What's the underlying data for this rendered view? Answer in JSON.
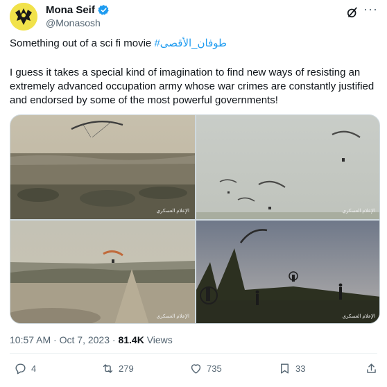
{
  "author": {
    "name": "Mona Seif",
    "handle": "@Monasosh",
    "avatar_icon": "eagle-avatar-icon"
  },
  "tweet": {
    "line1": "Something out of a sci fi movie ",
    "hashtag": "#طوفان_الأقصى",
    "body": "I guess it takes a special kind of imagination to find new ways of resisting an extremely advanced occupation army whose war crimes are constantly justified and endorsed by some of the most powerful governments!"
  },
  "media": {
    "watermark": "الإعلام العسكري"
  },
  "meta": {
    "time": "10:57 AM",
    "date": "Oct 7, 2023",
    "views_count": "81.4K",
    "views_label": "Views"
  },
  "actions": {
    "replies": "4",
    "reposts": "279",
    "likes": "735",
    "bookmarks": "33"
  },
  "colors": {
    "accent": "#1d9bf0",
    "text": "#0f1419",
    "muted": "#536471"
  }
}
